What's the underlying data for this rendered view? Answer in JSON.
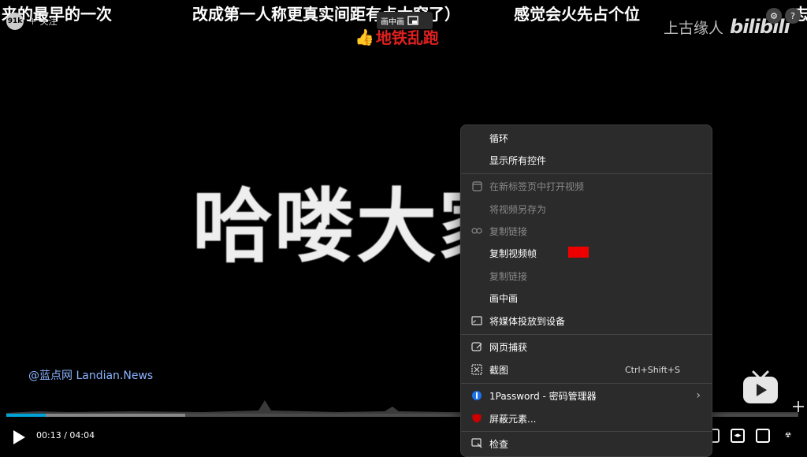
{
  "danmaku": [
    "来的最早的一次",
    "改成第一人称更真实间距有点太窄了）",
    "感觉会火先占个位",
    "志"
  ],
  "uploader": {
    "avatar_text": "91k",
    "follow_label": "＋ 关注"
  },
  "pip_chip": {
    "label": "画中画"
  },
  "video_title": {
    "emoji": "👍",
    "text": "地铁乱跑"
  },
  "watermark": {
    "name": "上古缘人",
    "logo": "bilibili"
  },
  "big_text": "哈喽大家",
  "site_watermark": "@蓝点网 Landian.News",
  "player": {
    "current_time": "00:13",
    "separator": "/",
    "duration": "04:04",
    "progress": 0.05,
    "buffered": 0.226
  },
  "context_menu": {
    "items": [
      {
        "label": "循环",
        "enabled": true,
        "icon": ""
      },
      {
        "label": "显示所有控件",
        "enabled": true,
        "icon": ""
      },
      {
        "label": "在新标签页中打开视频",
        "enabled": false,
        "icon": "new-tab-icon"
      },
      {
        "label": "将视频另存为",
        "enabled": false,
        "icon": ""
      },
      {
        "label": "复制链接",
        "enabled": false,
        "icon": "link-icon"
      },
      {
        "label": "复制视频帧",
        "enabled": true,
        "icon": ""
      },
      {
        "label": "复制链接",
        "enabled": false,
        "icon": ""
      },
      {
        "label": "画中画",
        "enabled": true,
        "icon": ""
      },
      {
        "label": "将媒体投放到设备",
        "enabled": true,
        "icon": "cast-icon"
      },
      {
        "label": "网页捕获",
        "enabled": true,
        "icon": "web-capture-icon"
      },
      {
        "label": "截图",
        "enabled": true,
        "icon": "screenshot-icon",
        "shortcut": "Ctrl+Shift+S"
      },
      {
        "label": "1Password - 密码管理器",
        "enabled": true,
        "icon": "1password-icon",
        "submenu": true
      },
      {
        "label": "屏蔽元素...",
        "enabled": true,
        "icon": "ublock-icon"
      },
      {
        "label": "检查",
        "enabled": true,
        "icon": "inspect-icon"
      }
    ]
  },
  "colors": {
    "progress": "#00a1d6",
    "title_red": "#e02020",
    "menu_bg": "#2b2b2b"
  }
}
